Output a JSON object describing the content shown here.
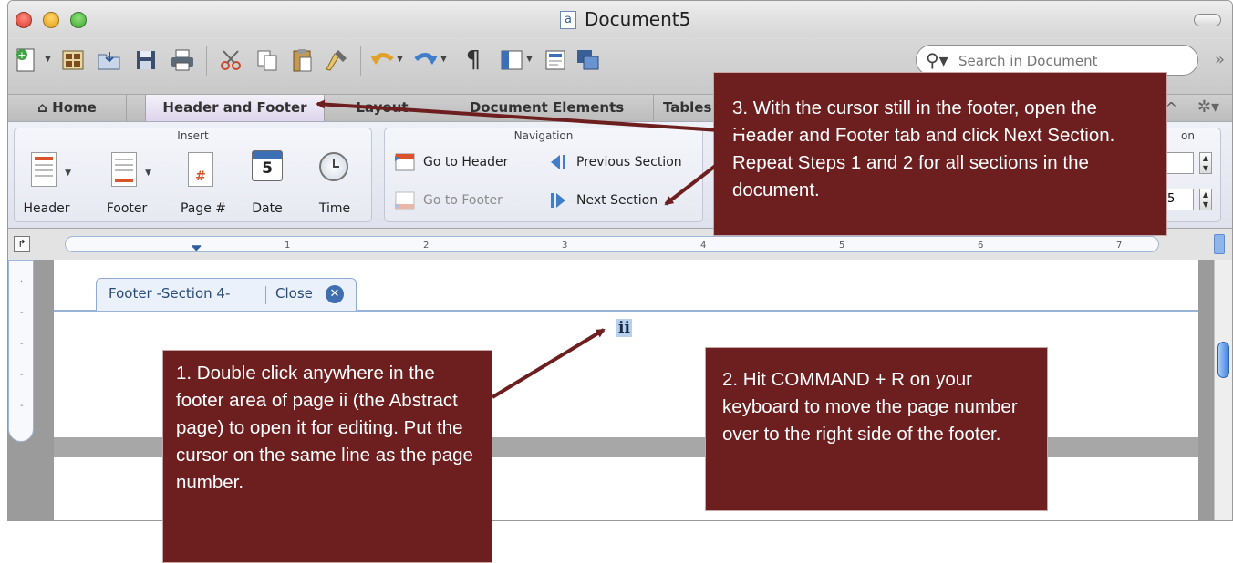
{
  "window": {
    "title": "Document5"
  },
  "toolbar": {
    "search_placeholder": "Search in Document"
  },
  "tabs": [
    "Home",
    "Header and Footer",
    "Layout",
    "Document Elements",
    "Tables"
  ],
  "ribbon": {
    "insert": {
      "title": "Insert",
      "header": "Header",
      "footer": "Footer",
      "page_num": "Page #",
      "date": "Date",
      "date_num": "5",
      "time": "Time"
    },
    "navigation": {
      "title": "Navigation",
      "go_to_header": "Go to Header",
      "go_to_footer": "Go to Footer",
      "previous_section": "Previous Section",
      "next_section": "Next Section"
    },
    "position": {
      "title": "on",
      "value2": "5"
    }
  },
  "ruler": {
    "marks": [
      "1",
      "2",
      "3",
      "4",
      "5",
      "6",
      "7"
    ]
  },
  "document": {
    "footer_label": "Footer -Section 4-",
    "close_label": "Close",
    "page_number": "ii"
  },
  "callouts": {
    "step1": "1. Double click anywhere in the footer area of page ii (the Abstract page) to open it for editing. Put the cursor on the same line as the page number.",
    "step2": "2. Hit COMMAND + R on your keyboard to move the page number over to the right side of the footer.",
    "step3": "3. With the cursor still in the footer, open the Header and Footer tab and click Next Section. Repeat Steps 1 and 2 for all sections in the document."
  },
  "colors": {
    "callout_bg": "#6d1f1f",
    "active_tab": "#dcd4ec",
    "page_number_highlight": "#b7d0ee",
    "close_icon": "#3f6fb0"
  }
}
